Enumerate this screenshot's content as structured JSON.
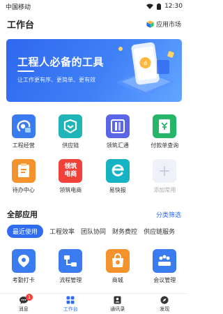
{
  "status_bar": {
    "carrier": "中国移动",
    "time": "12:30"
  },
  "header": {
    "title": "工作台",
    "market_label": "应用市场"
  },
  "banner": {
    "title": "工程人必备的工具",
    "subtitle": "让工作更有序、更简单、更有效"
  },
  "common_apps": [
    {
      "label": "工程经营",
      "icon": "project-icon",
      "color": "#3a7bef"
    },
    {
      "label": "供应链",
      "icon": "supply-chain-icon",
      "color": "#1fb5b8"
    },
    {
      "label": "领筑汇通",
      "icon": "lingzhu-icon",
      "color": "#5a66e6"
    },
    {
      "label": "付款单查询",
      "icon": "payment-query-icon",
      "color": "#27b56a"
    },
    {
      "label": "待办中心",
      "icon": "todo-icon",
      "color": "#f4932c"
    },
    {
      "label": "领筑电商",
      "icon": "ecommerce-icon",
      "color": "#f0423b",
      "tile_text": [
        "领筑",
        "电商"
      ]
    },
    {
      "label": "易快报",
      "icon": "ekuaibao-icon",
      "color": "#15b3c4"
    },
    {
      "label": "添加常用",
      "icon": "add-icon",
      "color": "#eef1f7"
    }
  ],
  "all_apps": {
    "title": "全部应用",
    "link": "分类筛选",
    "tabs": [
      "最近使用",
      "工程效率",
      "团队协同",
      "财务费控",
      "供应链服务"
    ],
    "active_tab": 0,
    "items": [
      {
        "label": "考勤打卡",
        "icon": "attendance-icon",
        "color": "#3a7bef"
      },
      {
        "label": "流程管理",
        "icon": "process-icon",
        "color": "#3a7bef"
      },
      {
        "label": "商城",
        "icon": "mall-icon",
        "color": "#f4932c"
      },
      {
        "label": "会议管理",
        "icon": "meeting-icon",
        "color": "#3a7bef"
      }
    ]
  },
  "tabbar": {
    "items": [
      {
        "label": "消息",
        "icon": "message-icon",
        "badge": "1"
      },
      {
        "label": "工作台",
        "icon": "workbench-icon",
        "active": true
      },
      {
        "label": "通讯录",
        "icon": "contacts-icon"
      },
      {
        "label": "发现",
        "icon": "discover-icon"
      }
    ]
  }
}
